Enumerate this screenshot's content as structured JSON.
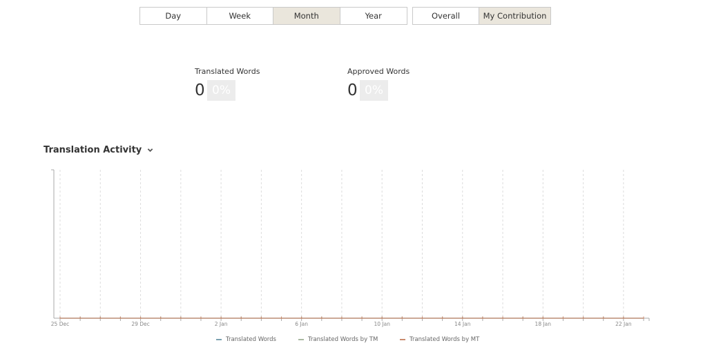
{
  "period_tabs": [
    {
      "label": "Day",
      "active": false
    },
    {
      "label": "Week",
      "active": false
    },
    {
      "label": "Month",
      "active": true
    },
    {
      "label": "Year",
      "active": false
    }
  ],
  "scope_tabs": [
    {
      "label": "Overall",
      "active": false
    },
    {
      "label": "My Contribution",
      "active": true
    }
  ],
  "stats": {
    "translated": {
      "label": "Translated Words",
      "count": "0",
      "percent": "0%"
    },
    "approved": {
      "label": "Approved Words",
      "count": "0",
      "percent": "0%"
    }
  },
  "section": {
    "title": "Translation Activity",
    "toggle_icon": "chevron-down-icon"
  },
  "chart_data": {
    "type": "line",
    "x": [
      "25 Dec",
      "26 Dec",
      "27 Dec",
      "28 Dec",
      "29 Dec",
      "30 Dec",
      "31 Dec",
      "1 Jan",
      "2 Jan",
      "3 Jan",
      "4 Jan",
      "5 Jan",
      "6 Jan",
      "7 Jan",
      "8 Jan",
      "9 Jan",
      "10 Jan",
      "11 Jan",
      "12 Jan",
      "13 Jan",
      "14 Jan",
      "15 Jan",
      "16 Jan",
      "17 Jan",
      "18 Jan",
      "19 Jan",
      "20 Jan",
      "21 Jan",
      "22 Jan",
      "23 Jan"
    ],
    "tick_labels": [
      "25 Dec",
      "29 Dec",
      "2 Jan",
      "6 Jan",
      "10 Jan",
      "14 Jan",
      "18 Jan",
      "22 Jan"
    ],
    "series": [
      {
        "name": "Translated Words",
        "color": "#7aa0b0",
        "values": [
          0,
          0,
          0,
          0,
          0,
          0,
          0,
          0,
          0,
          0,
          0,
          0,
          0,
          0,
          0,
          0,
          0,
          0,
          0,
          0,
          0,
          0,
          0,
          0,
          0,
          0,
          0,
          0,
          0,
          0
        ]
      },
      {
        "name": "Translated Words by TM",
        "color": "#a9b8a0",
        "values": [
          0,
          0,
          0,
          0,
          0,
          0,
          0,
          0,
          0,
          0,
          0,
          0,
          0,
          0,
          0,
          0,
          0,
          0,
          0,
          0,
          0,
          0,
          0,
          0,
          0,
          0,
          0,
          0,
          0,
          0
        ]
      },
      {
        "name": "Translated Words by MT",
        "color": "#c98a6e",
        "values": [
          0,
          0,
          0,
          0,
          0,
          0,
          0,
          0,
          0,
          0,
          0,
          0,
          0,
          0,
          0,
          0,
          0,
          0,
          0,
          0,
          0,
          0,
          0,
          0,
          0,
          0,
          0,
          0,
          0,
          0
        ]
      }
    ],
    "ylim": [
      0,
      1
    ],
    "grid": "vertical dashed",
    "legend": "bottom-center"
  }
}
